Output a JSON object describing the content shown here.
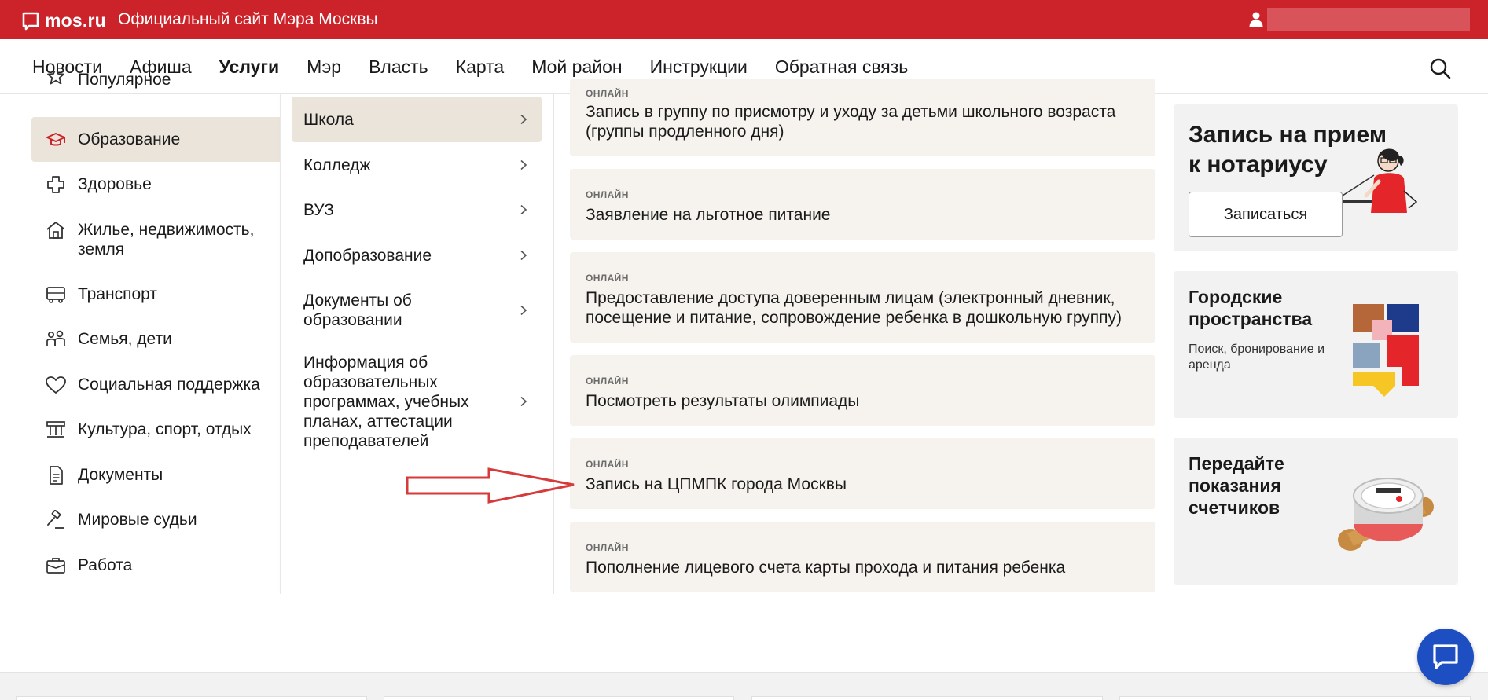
{
  "header": {
    "logo_text": "mos.ru",
    "site_title": "Официальный сайт Мэра Москвы"
  },
  "nav": {
    "items": [
      {
        "label": "Новости"
      },
      {
        "label": "Афиша"
      },
      {
        "label": "Услуги"
      },
      {
        "label": "Мэр"
      },
      {
        "label": "Власть"
      },
      {
        "label": "Карта"
      },
      {
        "label": "Мой район"
      },
      {
        "label": "Инструкции"
      },
      {
        "label": "Обратная связь"
      }
    ],
    "active": "Услуги"
  },
  "categories": [
    {
      "label": "Популярное",
      "icon": "star-icon"
    },
    {
      "label": "Образование",
      "icon": "graduation-cap-icon",
      "active": true
    },
    {
      "label": "Здоровье",
      "icon": "health-cross-icon"
    },
    {
      "label": "Жилье, недвижимость, земля",
      "icon": "house-icon"
    },
    {
      "label": "Транспорт",
      "icon": "bus-icon"
    },
    {
      "label": "Семья, дети",
      "icon": "family-icon"
    },
    {
      "label": "Социальная поддержка",
      "icon": "heart-icon"
    },
    {
      "label": "Культура, спорт, отдых",
      "icon": "museum-icon"
    },
    {
      "label": "Документы",
      "icon": "document-icon"
    },
    {
      "label": "Мировые судьи",
      "icon": "gavel-icon"
    },
    {
      "label": "Работа",
      "icon": "briefcase-icon"
    }
  ],
  "subcategories": [
    {
      "label": "Школа",
      "active": true
    },
    {
      "label": "Колледж"
    },
    {
      "label": "ВУЗ"
    },
    {
      "label": "Допобразование"
    },
    {
      "label": "Документы об образовании"
    },
    {
      "label": "Информация об образовательных программах, учебных планах, аттестации преподавателей"
    }
  ],
  "services": [
    {
      "tag": "ОНЛАЙН",
      "title": "Запись в группу по присмотру и уходу за детьми школьного возраста (группы продленного дня)"
    },
    {
      "tag": "ОНЛАЙН",
      "title": "Заявление на льготное питание"
    },
    {
      "tag": "ОНЛАЙН",
      "title": "Предоставление доступа доверенным лицам (электронный дневник, посещение и питание, сопровождение ребенка в дошкольную группу)"
    },
    {
      "tag": "ОНЛАЙН",
      "title": "Посмотреть результаты олимпиады"
    },
    {
      "tag": "ОНЛАЙН",
      "title": "Запись на ЦПМПК города Москвы"
    },
    {
      "tag": "ОНЛАЙН",
      "title": "Пополнение лицевого счета карты прохода и питания ребенка"
    }
  ],
  "promos": {
    "notary": {
      "title": "Запись на прием к нотариусу",
      "button": "Записаться"
    },
    "spaces": {
      "title": "Городские пространства",
      "subtitle": "Поиск, бронирование и аренда"
    },
    "meters": {
      "title": "Передайте показания счетчиков"
    }
  },
  "colors": {
    "brand_red": "#cc2229",
    "active_bg": "#eae4da",
    "card_bg": "#f6f3ee",
    "promo_bg": "#f2f2f2",
    "chat_blue": "#1e4fc2",
    "annotation_red": "#d63a3a"
  }
}
